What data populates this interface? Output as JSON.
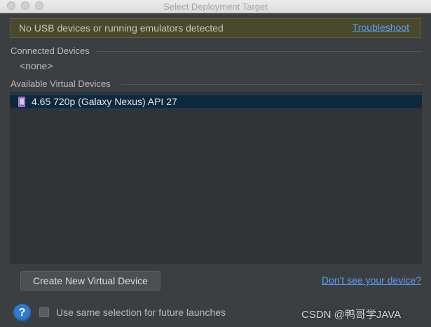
{
  "window": {
    "title": "Select Deployment Target"
  },
  "banner": {
    "message": "No USB devices or running emulators detected",
    "troubleshoot_link": "Troubleshoot"
  },
  "connected": {
    "header": "Connected Devices",
    "empty_text": "<none>"
  },
  "available": {
    "header": "Available Virtual Devices",
    "devices": [
      {
        "label": "4.65  720p (Galaxy Nexus) API 27",
        "icon": "phone-icon"
      }
    ]
  },
  "actions": {
    "create_button": "Create New Virtual Device",
    "dont_see_link": "Don't see your device?"
  },
  "footer": {
    "help_symbol": "?",
    "remember_label": "Use same selection for future launches",
    "watermark": "CSDN @鸭哥学JAVA"
  },
  "colors": {
    "background": "#3c3f41",
    "banner_background": "#49492c",
    "link": "#589df6",
    "selection": "#0d293e",
    "help_icon": "#2f7bd1"
  }
}
